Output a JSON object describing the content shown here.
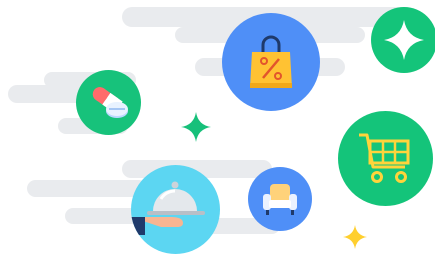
{
  "illustration": {
    "background": "#ffffff",
    "streak_color": "#e9ebee",
    "icons": [
      {
        "name": "shopping-bag-discount-icon",
        "circle_color": "#4f8ff7"
      },
      {
        "name": "sparkle-star-icon",
        "circle_color": "#14c47a"
      },
      {
        "name": "pills-medicine-icon",
        "circle_color": "#17c27b"
      },
      {
        "name": "shopping-cart-icon",
        "circle_color": "#14c47a"
      },
      {
        "name": "food-cloche-icon",
        "circle_color": "#5cd6f2"
      },
      {
        "name": "armchair-furniture-icon",
        "circle_color": "#4f8ff7"
      }
    ],
    "sparkles": [
      {
        "name": "sparkle-green-icon",
        "color": "#16c07a"
      },
      {
        "name": "sparkle-yellow-icon",
        "color": "#ffcf2e"
      }
    ]
  }
}
